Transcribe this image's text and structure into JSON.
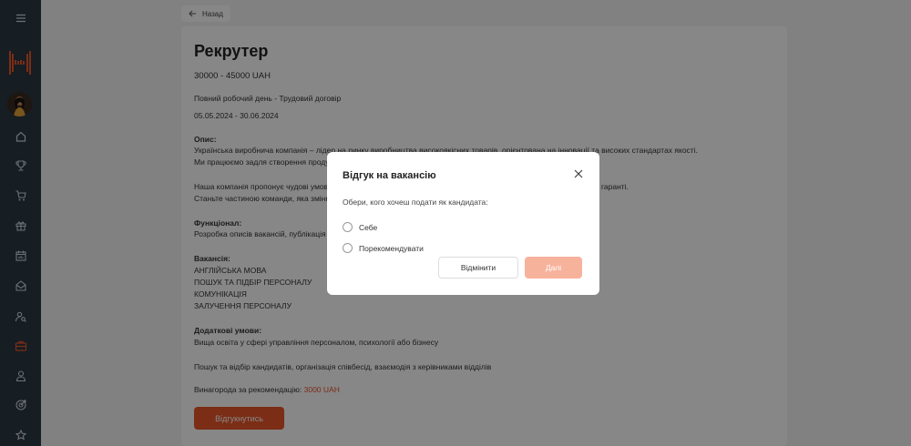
{
  "nav": {
    "back_label": "Назад"
  },
  "job": {
    "title": "Рекрутер",
    "salary": "30000 - 45000 UAH",
    "employment": "Повний робочий день  -  Трудовий договір",
    "dates": "05.05.2024 - 30.06.2024",
    "description_label": "Опис:",
    "description_lines": [
      "Українська виробнича компанія – лідер на ринку виробництва високоякісних товарів, орієнтована на інновації та високих стандартах якості.",
      "Ми працюємо задля створення продукції,",
      "Наша компанія пропонує чудові умови",
      "Станьте частиною команди, яка змінює"
    ],
    "description_tail": "гаранті.",
    "functional_label": "Функціонал:",
    "functional_line": "Розробка описів вакансій, публікація",
    "vacancies_label": "Вакансія:",
    "vacancies": [
      "АНГЛІЙСЬКА МОВА",
      "ПОШУК ТА ПІДБІР ПЕРСОНАЛУ",
      "КОМУНІКАЦІЯ",
      "ЗАЛУЧЕННЯ ПЕРСОНАЛУ"
    ],
    "extra_label": "Додаткові умови:",
    "extra_line": "Вища освіта у сфері управління персоналом, психології або бізнесу",
    "duties_line": "Пошук та відбір кандидатів, організація співбесід, взаємодія з керівниками відділів",
    "reward_label": "Винагорода за рекомендацію:",
    "reward_value": "3000 UAH",
    "apply_label": "Відгукнутись"
  },
  "modal": {
    "title": "Відгук на вакансію",
    "subtitle": "Обери, кого хочеш подати як кандидата:",
    "options": [
      "Себе",
      "Порекомендувати"
    ],
    "cancel_label": "Відмінити",
    "next_label": "Далі"
  },
  "colors": {
    "sidebar": "#2b3742",
    "accent": "#e8552a",
    "accent_disabled": "#f7b29c"
  },
  "sidebar_icons": [
    "menu-icon",
    "home-icon",
    "trophy-icon",
    "cart-icon",
    "gift-icon",
    "calendar-icon",
    "mail-icon",
    "user-search-icon",
    "briefcase-icon",
    "user-icon",
    "target-icon",
    "star-icon"
  ]
}
